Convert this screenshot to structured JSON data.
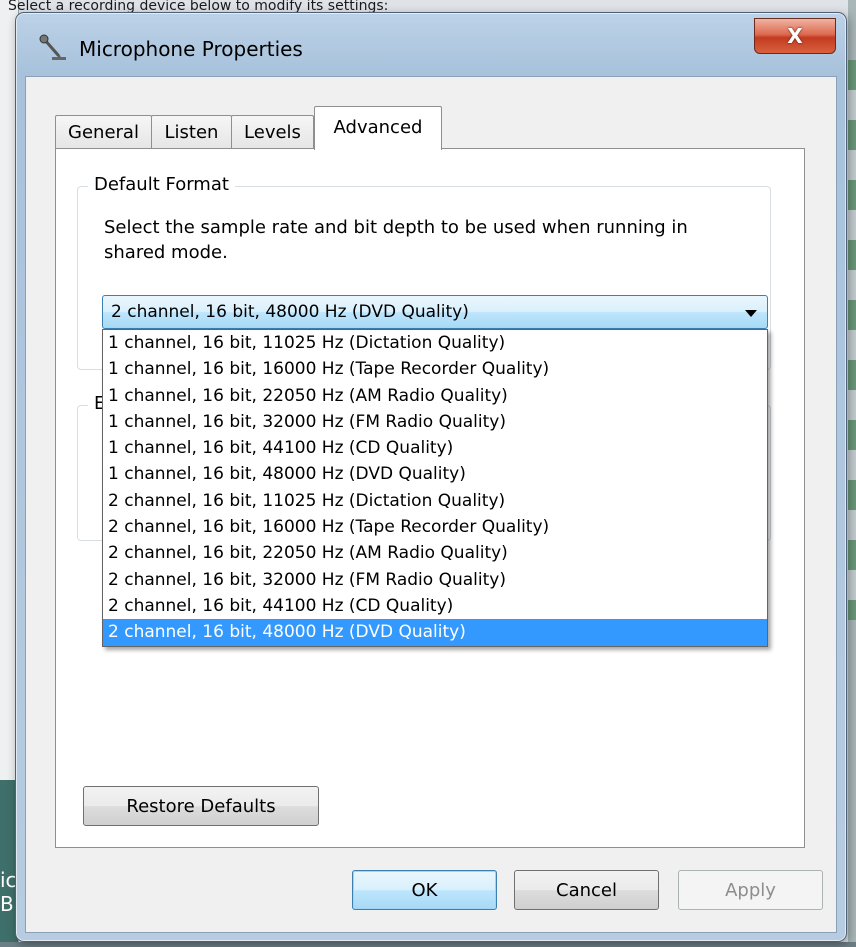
{
  "background": {
    "top_text": "Select a recording device below to modify its settings:",
    "left_text": "ic\nB)"
  },
  "window": {
    "title": "Microphone Properties",
    "close_label": "X",
    "icon": "microphone-icon"
  },
  "tabs": [
    {
      "label": "General",
      "active": false
    },
    {
      "label": "Listen",
      "active": false
    },
    {
      "label": "Levels",
      "active": false
    },
    {
      "label": "Advanced",
      "active": true
    }
  ],
  "default_format": {
    "legend": "Default Format",
    "description": "Select the sample rate and bit depth to be used when running in shared mode.",
    "selected": "2 channel, 16 bit, 48000 Hz (DVD Quality)",
    "options": [
      "1 channel, 16 bit, 11025 Hz (Dictation Quality)",
      "1 channel, 16 bit, 16000 Hz (Tape Recorder Quality)",
      "1 channel, 16 bit, 22050 Hz (AM Radio Quality)",
      "1 channel, 16 bit, 32000 Hz (FM Radio Quality)",
      "1 channel, 16 bit, 44100 Hz (CD Quality)",
      "1 channel, 16 bit, 48000 Hz (DVD Quality)",
      "2 channel, 16 bit, 11025 Hz (Dictation Quality)",
      "2 channel, 16 bit, 16000 Hz (Tape Recorder Quality)",
      "2 channel, 16 bit, 22050 Hz (AM Radio Quality)",
      "2 channel, 16 bit, 32000 Hz (FM Radio Quality)",
      "2 channel, 16 bit, 44100 Hz (CD Quality)",
      "2 channel, 16 bit, 48000 Hz (DVD Quality)"
    ],
    "selected_index": 11
  },
  "exclusive_group": {
    "legend": "E"
  },
  "buttons": {
    "restore": "Restore Defaults",
    "ok": "OK",
    "cancel": "Cancel",
    "apply": "Apply"
  }
}
